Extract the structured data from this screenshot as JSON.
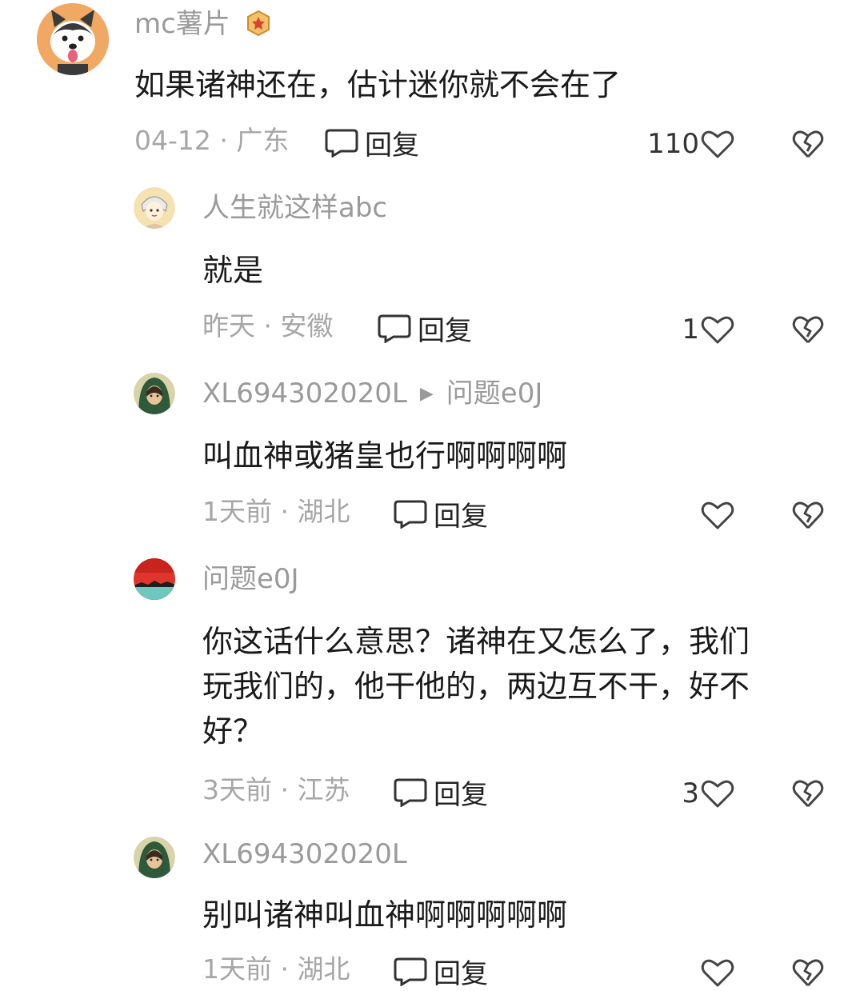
{
  "comments": [
    {
      "username": "mc薯片",
      "text": "如果诸神还在，估计迷你就不会在了",
      "meta": "04-12 · 广东",
      "reply_label": "回复",
      "likes": "110"
    },
    {
      "username": "人生就这样abc",
      "text": "就是",
      "meta": "昨天 · 安徽",
      "reply_label": "回复",
      "likes": "1"
    },
    {
      "username": "XL694302020L",
      "reply_to": "问题e0J",
      "text": "叫血神或猪皇也行啊啊啊啊",
      "meta": "1天前 · 湖北",
      "reply_label": "回复",
      "likes": ""
    },
    {
      "username": "问题e0J",
      "text_lines": [
        "你这话什么意思？诸神在又怎么了，我们",
        "玩我们的，他干他的，两边互不干，好不",
        "好？"
      ],
      "meta": "3天前 · 江苏",
      "reply_label": "回复",
      "likes": "3"
    },
    {
      "username": "XL694302020L",
      "text": "别叫诸神叫血神啊啊啊啊啊",
      "meta": "1天前 · 湖北",
      "reply_label": "回复",
      "likes": ""
    }
  ],
  "icons": {
    "reply": "speech-bubble-icon",
    "like": "heart-outline-icon",
    "dislike": "broken-heart-icon",
    "badge": "star-badge-icon"
  },
  "colors": {
    "username": "#9a9a9a",
    "meta": "#a6a6a6",
    "text": "#1a1a1a",
    "badge": "#e8a33a"
  }
}
